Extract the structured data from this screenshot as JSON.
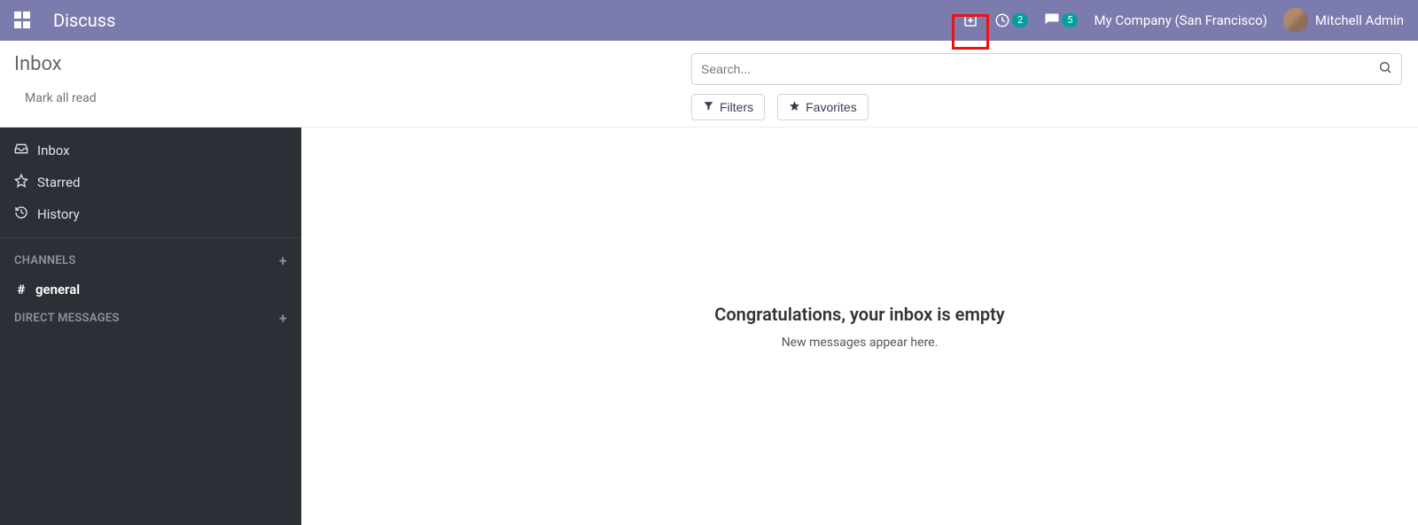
{
  "header": {
    "brand": "Discuss",
    "activity_badge": "2",
    "messages_badge": "5",
    "company": "My Company (San Francisco)",
    "user": "Mitchell Admin"
  },
  "control": {
    "title": "Inbox",
    "mark_all": "Mark all read",
    "search_placeholder": "Search...",
    "filters_label": "Filters",
    "favorites_label": "Favorites"
  },
  "sidebar": {
    "inbox": "Inbox",
    "starred": "Starred",
    "history": "History",
    "channels_header": "CHANNELS",
    "channel_general": "general",
    "dm_header": "DIRECT MESSAGES"
  },
  "empty": {
    "title": "Congratulations, your inbox is empty",
    "subtitle": "New messages appear here."
  }
}
